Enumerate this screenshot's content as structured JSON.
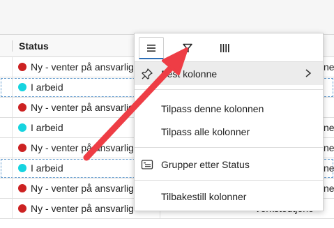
{
  "grid": {
    "status_header": "Status",
    "rows": [
      {
        "status": "Ny - venter på ansvarlig",
        "right": "ne",
        "color": "#cc2222"
      },
      {
        "status": "I arbeid",
        "right": "",
        "color": "#16d4e0"
      },
      {
        "status": "Ny - venter på ansvarlig",
        "right": "",
        "color": "#cc2222"
      },
      {
        "status": "I arbeid",
        "right": "ne",
        "color": "#16d4e0"
      },
      {
        "status": "Ny - venter på ansvarlig",
        "right": "ne",
        "color": "#cc2222"
      },
      {
        "status": "I arbeid",
        "right": "ne",
        "color": "#16d4e0"
      },
      {
        "status": "Ny - venter på ansvarlig",
        "right": "ne",
        "color": "#cc2222"
      },
      {
        "status": "Ny - venter på ansvarlig",
        "right": "Verkstedtjene",
        "color": "#cc2222"
      }
    ]
  },
  "column_menu": {
    "tabs": [
      "menu-icon",
      "filter-icon",
      "columns-icon"
    ],
    "items": {
      "pin": "Fest kolonne",
      "autosize_this": "Tilpass denne kolonnen",
      "autosize_all": "Tilpass alle kolonner",
      "group_by": "Grupper etter Status",
      "reset": "Tilbakestill kolonner"
    }
  },
  "colors": {
    "accent": "#2d6fb7",
    "arrow": "#ee3d45"
  }
}
